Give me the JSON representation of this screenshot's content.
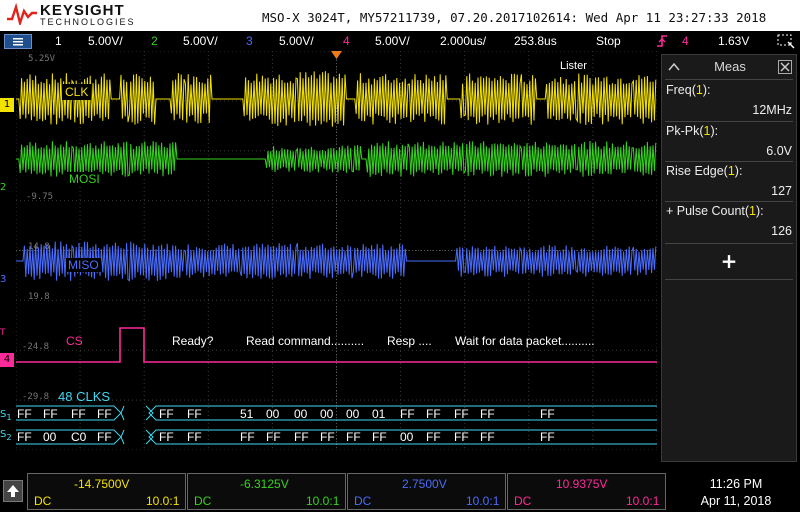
{
  "header": {
    "brand": "KEYSIGHT",
    "brand_sub": "TECHNOLOGIES",
    "info": "MSO-X 3024T, MY57211739, 07.20.2017102614: Wed Apr 11 23:27:33 2018"
  },
  "status_bar": {
    "ch1_num": "1",
    "ch1_scale": "5.00V/",
    "ch2_num": "2",
    "ch2_scale": "5.00V/",
    "ch3_num": "3",
    "ch3_scale": "5.00V/",
    "ch4_num": "4",
    "ch4_scale": "5.00V/",
    "timebase": "2.000us/",
    "delay": "253.8us",
    "run_state": "Stop",
    "trigger_channel": "4",
    "trigger_level": "1.63V"
  },
  "screen": {
    "labels": {
      "clk": "CLK",
      "mosi": "MOSI",
      "miso": "MISO",
      "cs": "CS",
      "clks": "48 CLKS",
      "ready": "Ready?",
      "read_cmd": "Read command..........",
      "resp": "Resp ....",
      "wait": "Wait for data packet..........",
      "lister": "Lister"
    },
    "levels": {
      "l1": "5.25V",
      "l2": "-9.75",
      "l3": "14.8",
      "l4": "19.8",
      "l5": "-24.8",
      "l6": "-29.8"
    },
    "bus_s1": [
      "FF",
      "FF",
      "FF",
      "FF",
      "FF",
      "FF",
      "51",
      "00",
      "00",
      "00",
      "00",
      "01",
      "FF",
      "FF",
      "FF",
      "FF",
      "FF"
    ],
    "bus_s2": [
      "FF",
      "00",
      "C0",
      "FF",
      "FF",
      "FF",
      "FF",
      "FF",
      "FF",
      "FF",
      "FF",
      "FF",
      "00",
      "FF",
      "FF",
      "FF",
      "FF"
    ]
  },
  "meas": {
    "title": "Meas",
    "items": [
      {
        "name": "Freq(",
        "ch": "1",
        "close": "):",
        "value": "12MHz"
      },
      {
        "name": "Pk-Pk(",
        "ch": "1",
        "close": "):",
        "value": "6.0V"
      },
      {
        "name": "Rise Edge(",
        "ch": "1",
        "close": "):",
        "value": "127"
      },
      {
        "name": "+ Pulse Count(",
        "ch": "1",
        "close": "):",
        "value": "126"
      }
    ],
    "add": "+"
  },
  "bottom": {
    "channels": [
      {
        "value": "-14.7500V",
        "coupling": "DC",
        "probe": "10.0:1",
        "color": "#f4e200"
      },
      {
        "value": "-6.3125V",
        "coupling": "DC",
        "probe": "10.0:1",
        "color": "#35d21e"
      },
      {
        "value": "2.7500V",
        "coupling": "DC",
        "probe": "10.0:1",
        "color": "#4a6cff"
      },
      {
        "value": "10.9375V",
        "coupling": "DC",
        "probe": "10.0:1",
        "color": "#ff2a9a"
      }
    ],
    "time": "11:26 PM",
    "date": "Apr 11, 2018"
  },
  "colors": {
    "ch1": "#f4e200",
    "ch2": "#35d21e",
    "ch3": "#4a6cff",
    "ch4": "#ff2a9a",
    "bus": "#3fd7f0"
  }
}
